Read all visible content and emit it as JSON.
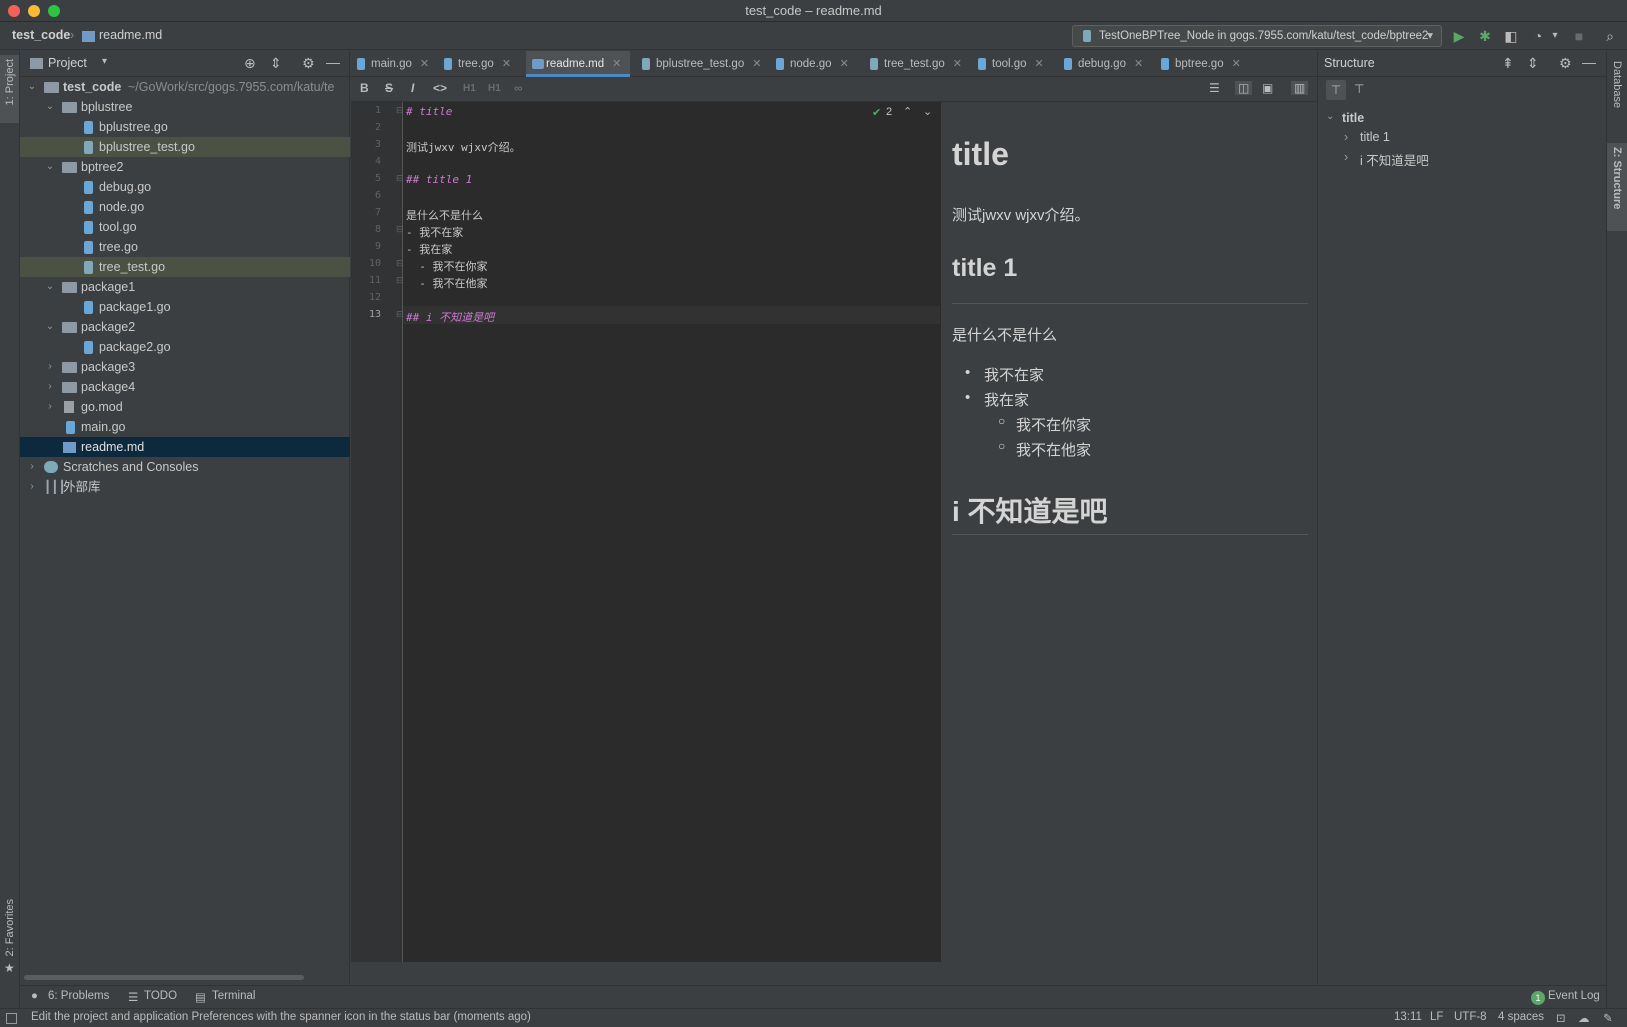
{
  "window": {
    "title": "test_code – readme.md"
  },
  "navbar": {
    "project": "test_code",
    "file": "readme.md",
    "run_config": "TestOneBPTree_Node in gogs.7955.com/katu/test_code/bptree2"
  },
  "left_strip": {
    "project_label": "1: Project",
    "favorites_label": "2: Favorites"
  },
  "right_strip": {
    "database_label": "Database",
    "structure_label": "Z: Structure"
  },
  "project_panel": {
    "title": "Project",
    "root_name": "test_code",
    "root_path": "~/GoWork/src/gogs.7955.com/katu/te",
    "items": [
      {
        "label": "bplustree"
      },
      {
        "label": "bplustree.go"
      },
      {
        "label": "bplustree_test.go"
      },
      {
        "label": "bptree2"
      },
      {
        "label": "debug.go"
      },
      {
        "label": "node.go"
      },
      {
        "label": "tool.go"
      },
      {
        "label": "tree.go"
      },
      {
        "label": "tree_test.go"
      },
      {
        "label": "package1"
      },
      {
        "label": "package1.go"
      },
      {
        "label": "package2"
      },
      {
        "label": "package2.go"
      },
      {
        "label": "package3"
      },
      {
        "label": "package4"
      },
      {
        "label": "go.mod"
      },
      {
        "label": "main.go"
      },
      {
        "label": "readme.md"
      },
      {
        "label": "Scratches and Consoles"
      },
      {
        "label": "外部库"
      }
    ]
  },
  "tabs": [
    {
      "label": "main.go"
    },
    {
      "label": "tree.go"
    },
    {
      "label": "readme.md"
    },
    {
      "label": "bplustree_test.go"
    },
    {
      "label": "node.go"
    },
    {
      "label": "tree_test.go"
    },
    {
      "label": "tool.go"
    },
    {
      "label": "debug.go"
    },
    {
      "label": "bptree.go"
    }
  ],
  "md_toolbar": {
    "h1": "H1",
    "h1b": "H1"
  },
  "editor": {
    "inspection_count": "2",
    "lines": [
      {
        "n": "1",
        "text": "# title"
      },
      {
        "n": "2",
        "text": ""
      },
      {
        "n": "3",
        "text": "测试jwxv wjxv介绍。"
      },
      {
        "n": "4",
        "text": ""
      },
      {
        "n": "5",
        "text": "## title 1"
      },
      {
        "n": "6",
        "text": ""
      },
      {
        "n": "7",
        "text": "是什么不是什么"
      },
      {
        "n": "8",
        "text": "- 我不在家"
      },
      {
        "n": "9",
        "text": "- 我在家"
      },
      {
        "n": "10",
        "text": "  - 我不在你家"
      },
      {
        "n": "11",
        "text": "  - 我不在他家"
      },
      {
        "n": "12",
        "text": ""
      },
      {
        "n": "13",
        "text": "## i 不知道是吧"
      }
    ]
  },
  "preview": {
    "h1": "title",
    "p1": "测试jwxv wjxv介绍。",
    "h2a": "title 1",
    "p2": "是什么不是什么",
    "li1": "我不在家",
    "li2": "我在家",
    "li2a": "我不在你家",
    "li2b": "我不在他家",
    "h2b": "i 不知道是吧"
  },
  "structure_panel": {
    "title": "Structure",
    "root": "title",
    "children": [
      "title 1",
      "i 不知道是吧"
    ]
  },
  "tool_windows": {
    "problems": "6: Problems",
    "todo": "TODO",
    "terminal": "Terminal",
    "event_log": "Event Log",
    "event_count": "1"
  },
  "status_bar": {
    "message": "Edit the project and application Preferences with the spanner icon in the status bar (moments ago)",
    "position": "13:11",
    "line_sep": "LF",
    "encoding": "UTF-8",
    "indent": "4 spaces"
  },
  "colors": {
    "accent": "#4a88c7",
    "run_green": "#59a869",
    "heading_purple": "#cc7bd1"
  }
}
